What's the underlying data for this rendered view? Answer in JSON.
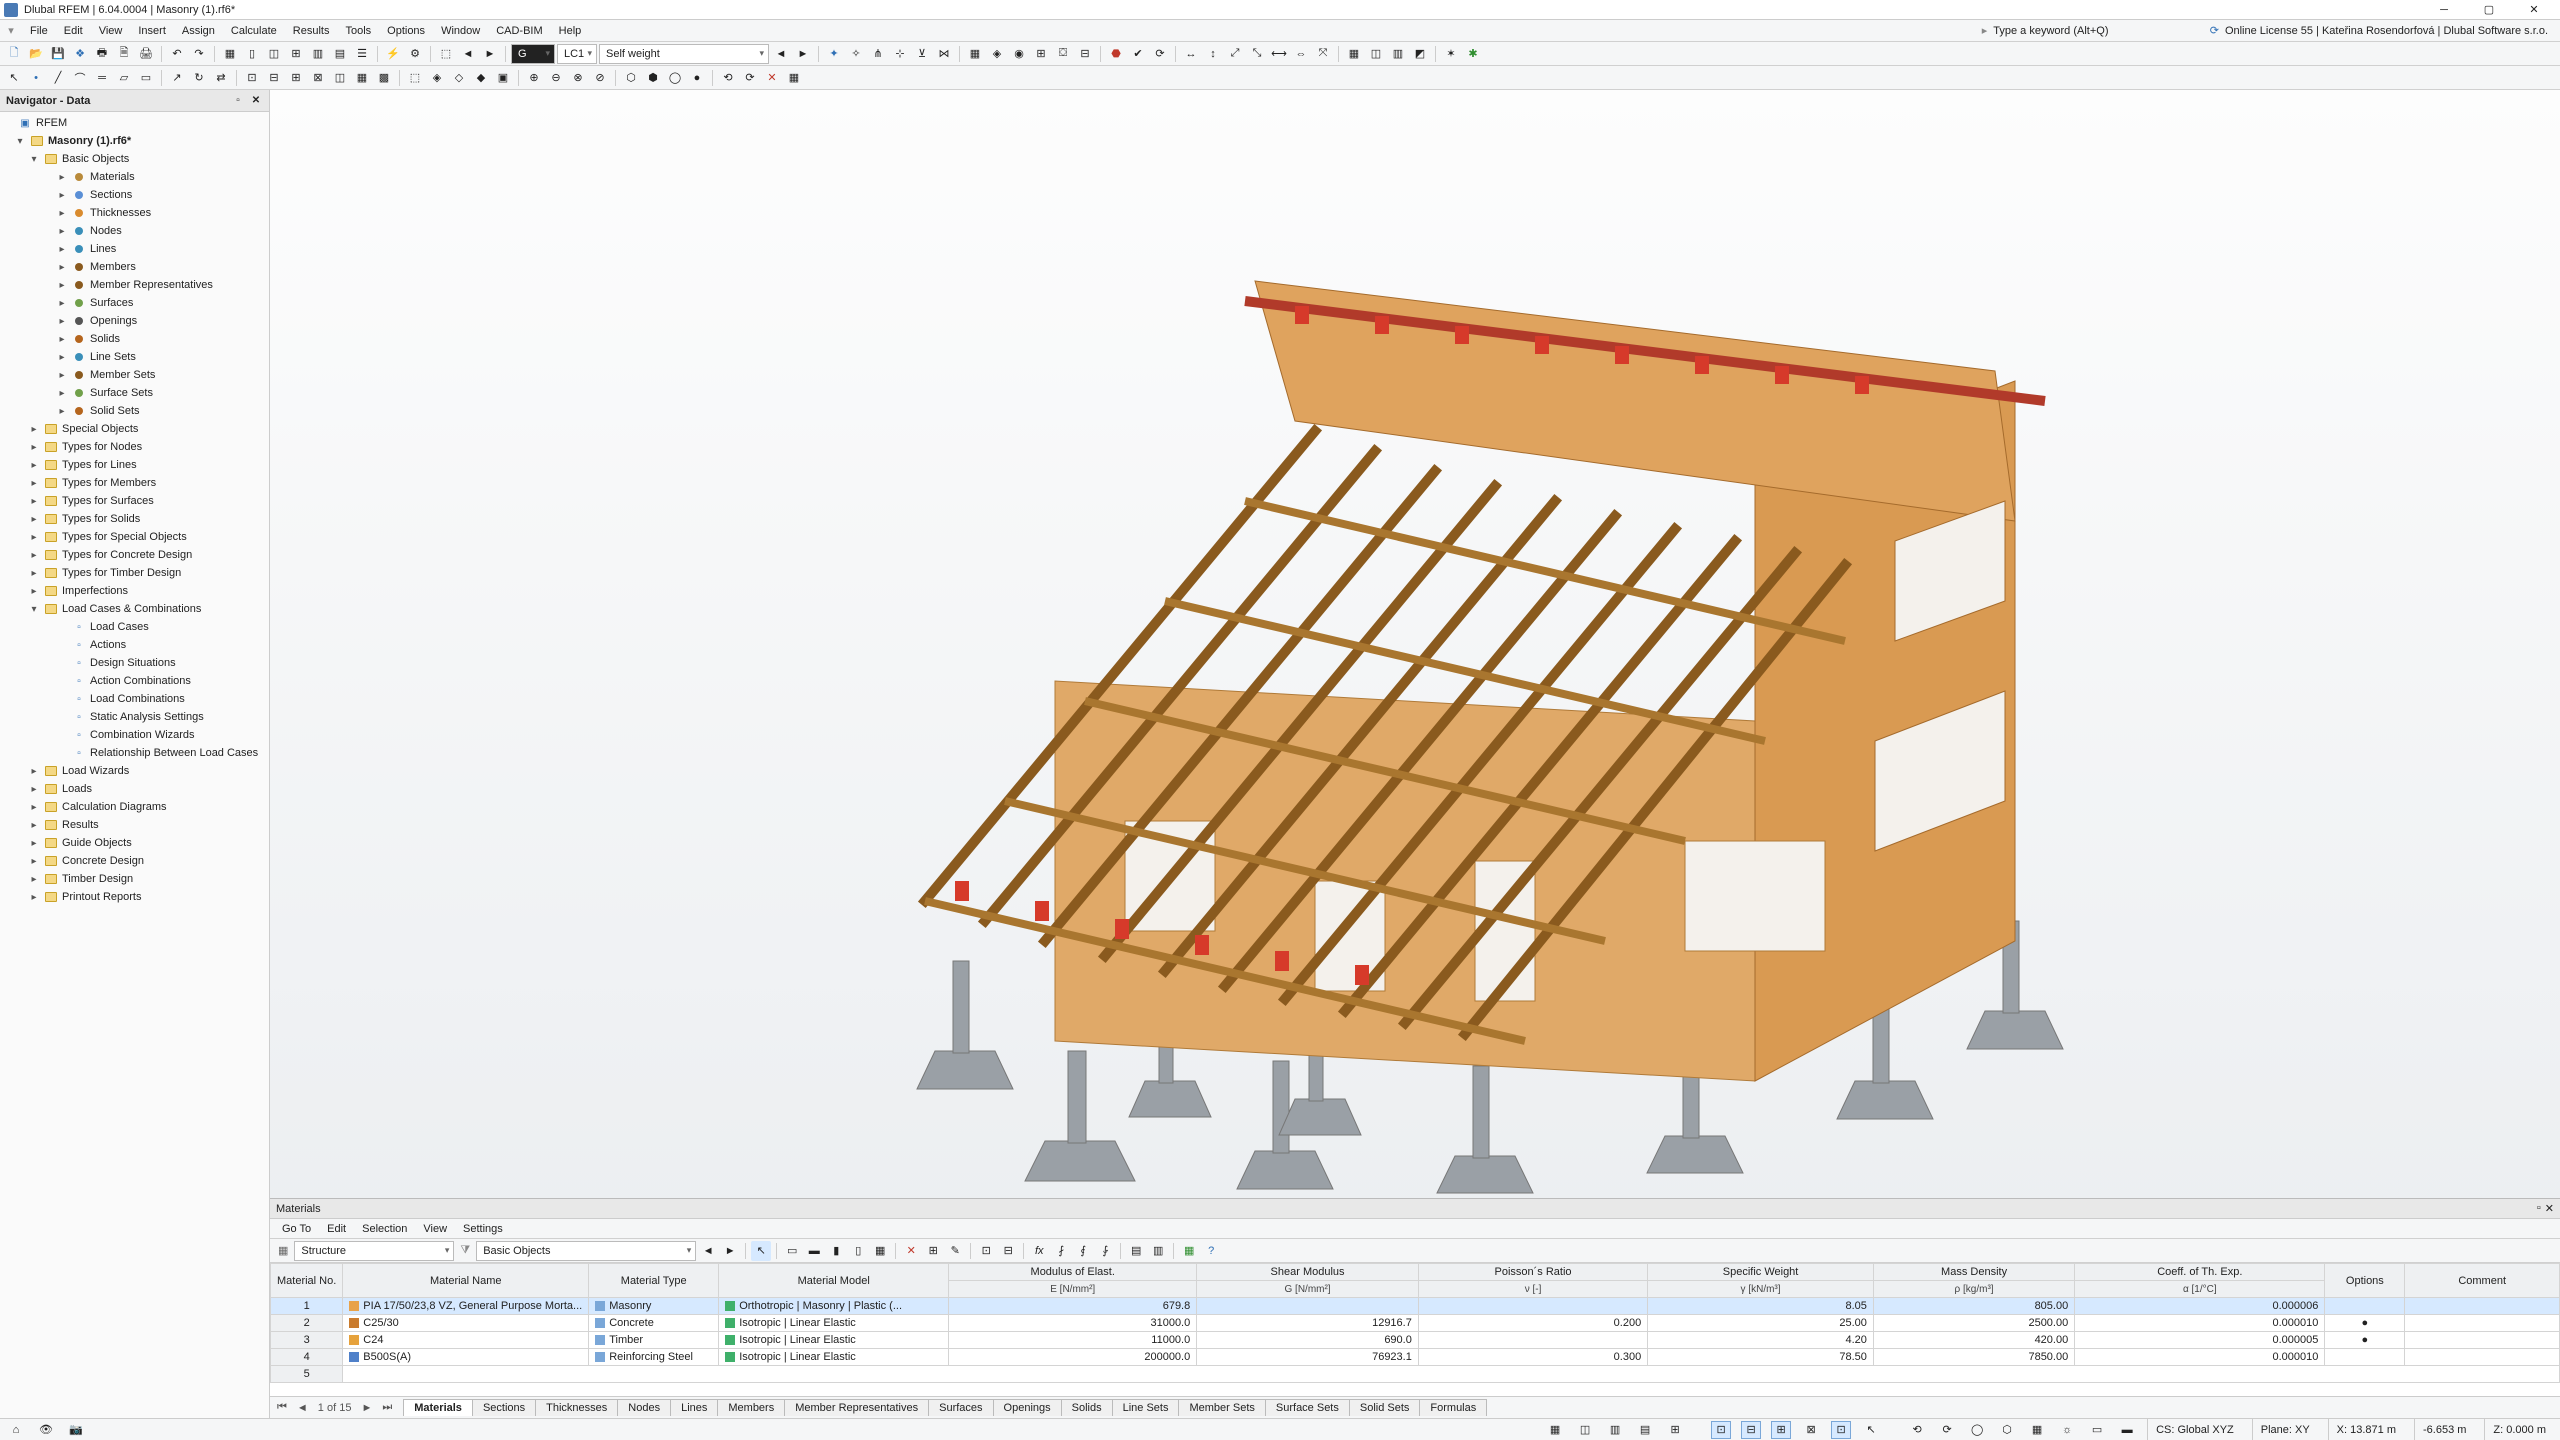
{
  "title": "Dlubal RFEM | 6.04.0004 | Masonry (1).rf6*",
  "menu": [
    "File",
    "Edit",
    "View",
    "Insert",
    "Assign",
    "Calculate",
    "Results",
    "Tools",
    "Options",
    "Window",
    "CAD-BIM",
    "Help"
  ],
  "search_placeholder": "Type a keyword (Alt+Q)",
  "license": "Online License 55 | Kateřina Rosendorfová | Dlubal Software s.r.o.",
  "load_case_code": "LC1",
  "load_case_name": "Self weight",
  "navigator": {
    "title": "Navigator - Data",
    "root": "RFEM",
    "model": "Masonry (1).rf6*",
    "basic_objects": "Basic Objects",
    "items_basic": [
      "Materials",
      "Sections",
      "Thicknesses",
      "Nodes",
      "Lines",
      "Members",
      "Member Representatives",
      "Surfaces",
      "Openings",
      "Solids",
      "Line Sets",
      "Member Sets",
      "Surface Sets",
      "Solid Sets"
    ],
    "items_top": [
      "Special Objects",
      "Types for Nodes",
      "Types for Lines",
      "Types for Members",
      "Types for Surfaces",
      "Types for Solids",
      "Types for Special Objects",
      "Types for Concrete Design",
      "Types for Timber Design",
      "Imperfections"
    ],
    "lcc": "Load Cases & Combinations",
    "items_lcc": [
      "Load Cases",
      "Actions",
      "Design Situations",
      "Action Combinations",
      "Load Combinations",
      "Static Analysis Settings",
      "Combination Wizards",
      "Relationship Between Load Cases"
    ],
    "items_tail": [
      "Load Wizards",
      "Loads",
      "Calculation Diagrams",
      "Results",
      "Guide Objects",
      "Concrete Design",
      "Timber Design",
      "Printout Reports"
    ]
  },
  "materials_panel": {
    "title": "Materials",
    "menu": [
      "Go To",
      "Edit",
      "Selection",
      "View",
      "Settings"
    ],
    "structure_dd": "Structure",
    "filter_dd": "Basic Objects",
    "pager": "1 of 15",
    "headers": {
      "no": "Material\nNo.",
      "name": "Material Name",
      "type": "Material\nType",
      "model": "Material Model",
      "e": "Modulus of Elast.",
      "e2": "E [N/mm²]",
      "g": "Shear Modulus",
      "g2": "G [N/mm²]",
      "nu": "Poisson´s Ratio",
      "nu2": "ν [-]",
      "gamma": "Specific Weight",
      "gamma2": "γ [kN/m³]",
      "rho": "Mass Density",
      "rho2": "ρ [kg/m³]",
      "alpha": "Coeff. of Th. Exp.",
      "alpha2": "α [1/°C]",
      "opt": "Options",
      "comment": "Comment"
    },
    "rows": [
      {
        "no": "1",
        "name": "PIA 17/50/23,8 VZ, General Purpose Morta...",
        "type": "Masonry",
        "model": "Orthotropic | Masonry | Plastic (...",
        "e": "679.8",
        "g": "",
        "nu": "",
        "gamma": "8.05",
        "rho": "805.00",
        "alpha": "0.000006",
        "mcolor": "#3fb06a",
        "ncolor": "#e8a24a",
        "sel": true
      },
      {
        "no": "2",
        "name": "C25/30",
        "type": "Concrete",
        "model": "Isotropic | Linear Elastic",
        "e": "31000.0",
        "g": "12916.7",
        "nu": "0.200",
        "gamma": "25.00",
        "rho": "2500.00",
        "alpha": "0.000010",
        "mcolor": "#3fb06a",
        "ncolor": "#c97b2e",
        "opt": "●"
      },
      {
        "no": "3",
        "name": "C24",
        "type": "Timber",
        "model": "Isotropic | Linear Elastic",
        "e": "11000.0",
        "g": "690.0",
        "nu": "",
        "gamma": "4.20",
        "rho": "420.00",
        "alpha": "0.000005",
        "mcolor": "#3fb06a",
        "ncolor": "#e6a23c",
        "opt": "●"
      },
      {
        "no": "4",
        "name": "B500S(A)",
        "type": "Reinforcing Steel",
        "model": "Isotropic | Linear Elastic",
        "e": "200000.0",
        "g": "76923.1",
        "nu": "0.300",
        "gamma": "78.50",
        "rho": "7850.00",
        "alpha": "0.000010",
        "mcolor": "#3fb06a",
        "ncolor": "#4f80c9"
      }
    ],
    "tabs": [
      "Materials",
      "Sections",
      "Thicknesses",
      "Nodes",
      "Lines",
      "Members",
      "Member Representatives",
      "Surfaces",
      "Openings",
      "Solids",
      "Line Sets",
      "Member Sets",
      "Surface Sets",
      "Solid Sets",
      "Formulas"
    ]
  },
  "status": {
    "cs": "CS: Global XYZ",
    "plane": "Plane: XY",
    "x": "X: 13.871 m",
    "y": "-6.653 m",
    "z": "Z: 0.000 m"
  }
}
